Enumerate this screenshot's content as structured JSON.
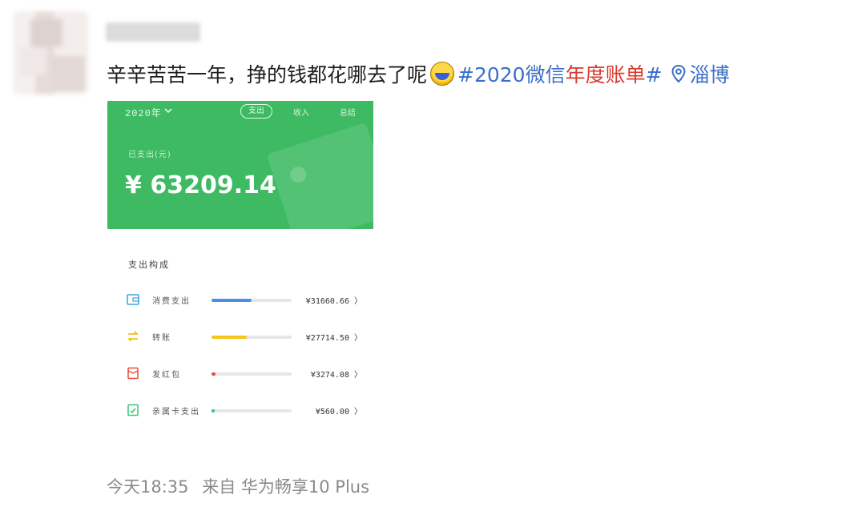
{
  "post": {
    "text": "辛辛苦苦一年，挣的钱都花哪去了呢",
    "hashtag_part1": "#2020微信",
    "hashtag_part2": "年度账单",
    "hashtag_end": "#",
    "location": "淄博"
  },
  "embedded": {
    "year_label": "2020年",
    "tab_active": "支出",
    "tab_2": "收入",
    "tab_3": "总结",
    "caption": "已支出(元)",
    "amount": "¥ 63209.14",
    "section_title": "支出构成",
    "rows": [
      {
        "label": "消费支出",
        "value": "¥31660.66 〉",
        "percent": 0.5,
        "color": "#4a90e2",
        "icon": "wallet-icon"
      },
      {
        "label": "转账",
        "value": "¥27714.50 〉",
        "percent": 0.44,
        "color": "#f5c518",
        "icon": "transfer-icon"
      },
      {
        "label": "发红包",
        "value": "¥3274.08 〉",
        "percent": 0.05,
        "color": "#e74c3c",
        "icon": "red-packet-icon"
      },
      {
        "label": "亲属卡支出",
        "value": "¥560.00 〉",
        "percent": 0.01,
        "color": "#2ecc71",
        "icon": "family-card-icon"
      }
    ]
  },
  "footer": {
    "time": "今天18:35",
    "source": "来自 华为畅享10 Plus"
  }
}
